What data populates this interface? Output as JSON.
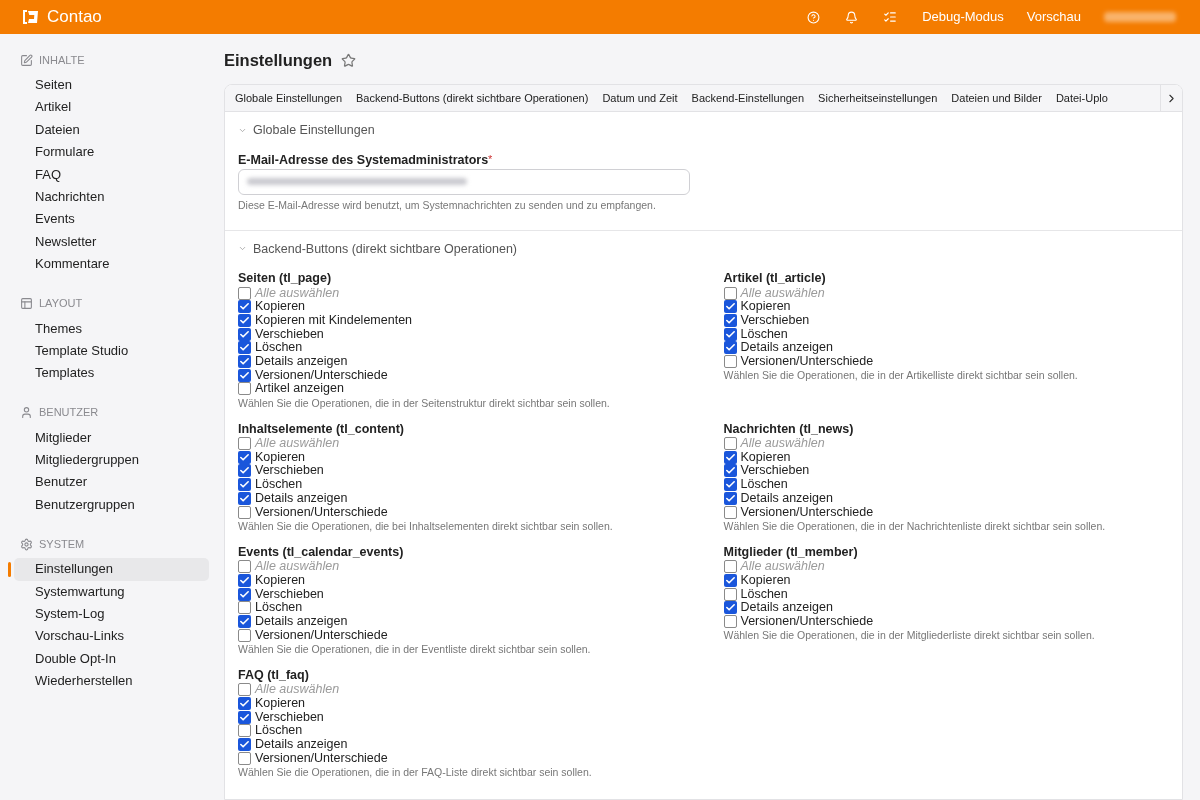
{
  "header": {
    "brand": "Contao",
    "links": [
      "Debug-Modus",
      "Vorschau"
    ]
  },
  "sidebar": [
    {
      "title": "INHALTE",
      "items": [
        {
          "label": "Seiten",
          "selected": false
        },
        {
          "label": "Artikel",
          "selected": false
        },
        {
          "label": "Dateien",
          "selected": false
        },
        {
          "label": "Formulare",
          "selected": false
        },
        {
          "label": "FAQ",
          "selected": false
        },
        {
          "label": "Nachrichten",
          "selected": false
        },
        {
          "label": "Events",
          "selected": false
        },
        {
          "label": "Newsletter",
          "selected": false
        },
        {
          "label": "Kommentare",
          "selected": false
        }
      ]
    },
    {
      "title": "LAYOUT",
      "items": [
        {
          "label": "Themes",
          "selected": false
        },
        {
          "label": "Template Studio",
          "selected": false
        },
        {
          "label": "Templates",
          "selected": false
        }
      ]
    },
    {
      "title": "BENUTZER",
      "items": [
        {
          "label": "Mitglieder",
          "selected": false
        },
        {
          "label": "Mitgliedergruppen",
          "selected": false
        },
        {
          "label": "Benutzer",
          "selected": false
        },
        {
          "label": "Benutzergruppen",
          "selected": false
        }
      ]
    },
    {
      "title": "SYSTEM",
      "items": [
        {
          "label": "Einstellungen",
          "selected": true
        },
        {
          "label": "Systemwartung",
          "selected": false
        },
        {
          "label": "System-Log",
          "selected": false
        },
        {
          "label": "Vorschau-Links",
          "selected": false
        },
        {
          "label": "Double Opt-In",
          "selected": false
        },
        {
          "label": "Wiederherstellen",
          "selected": false
        }
      ]
    }
  ],
  "page_title": "Einstellungen",
  "tabs": [
    "Globale Einstellungen",
    "Backend-Buttons (direkt sichtbare Operationen)",
    "Datum und Zeit",
    "Backend-Einstellungen",
    "Sicherheitseinstellungen",
    "Dateien und Bilder",
    "Datei-Uplo"
  ],
  "sections": [
    {
      "kind": "fields",
      "legend": "Globale Einstellungen",
      "fields": [
        {
          "label": "E-Mail-Adresse des Systemadministrators",
          "required_mark": "*",
          "help": "Diese E-Mail-Adresse wird benutzt, um Systemnachrichten zu senden und zu empfangen."
        }
      ]
    },
    {
      "kind": "checkbox_groups",
      "legend": "Backend-Buttons (direkt sichtbare Operationen)",
      "groups": [
        {
          "title": "Seiten (tl_page)",
          "help": "Wählen Sie die Operationen, die in der Seitenstruktur direkt sichtbar sein sollen.",
          "options": [
            {
              "kind": "select_all",
              "label": "Alle auswählen",
              "checked": false
            },
            {
              "kind": "option",
              "label": "Kopieren",
              "checked": true
            },
            {
              "kind": "option",
              "label": "Kopieren mit Kindelementen",
              "checked": true
            },
            {
              "kind": "option",
              "label": "Verschieben",
              "checked": true
            },
            {
              "kind": "option",
              "label": "Löschen",
              "checked": true
            },
            {
              "kind": "option",
              "label": "Details anzeigen",
              "checked": true
            },
            {
              "kind": "option",
              "label": "Versionen/Unterschiede",
              "checked": true
            },
            {
              "kind": "option",
              "label": "Artikel anzeigen",
              "checked": false
            }
          ]
        },
        {
          "title": "Artikel (tl_article)",
          "help": "Wählen Sie die Operationen, die in der Artikelliste direkt sichtbar sein sollen.",
          "options": [
            {
              "kind": "select_all",
              "label": "Alle auswählen",
              "checked": false
            },
            {
              "kind": "option",
              "label": "Kopieren",
              "checked": true
            },
            {
              "kind": "option",
              "label": "Verschieben",
              "checked": true
            },
            {
              "kind": "option",
              "label": "Löschen",
              "checked": true
            },
            {
              "kind": "option",
              "label": "Details anzeigen",
              "checked": true
            },
            {
              "kind": "option",
              "label": "Versionen/Unterschiede",
              "checked": false
            }
          ]
        },
        {
          "title": "Inhaltselemente (tl_content)",
          "help": "Wählen Sie die Operationen, die bei Inhaltselementen direkt sichtbar sein sollen.",
          "options": [
            {
              "kind": "select_all",
              "label": "Alle auswählen",
              "checked": false
            },
            {
              "kind": "option",
              "label": "Kopieren",
              "checked": true
            },
            {
              "kind": "option",
              "label": "Verschieben",
              "checked": true
            },
            {
              "kind": "option",
              "label": "Löschen",
              "checked": true
            },
            {
              "kind": "option",
              "label": "Details anzeigen",
              "checked": true
            },
            {
              "kind": "option",
              "label": "Versionen/Unterschiede",
              "checked": false
            }
          ]
        },
        {
          "title": "Nachrichten (tl_news)",
          "help": "Wählen Sie die Operationen, die in der Nachrichtenliste direkt sichtbar sein sollen.",
          "options": [
            {
              "kind": "select_all",
              "label": "Alle auswählen",
              "checked": false
            },
            {
              "kind": "option",
              "label": "Kopieren",
              "checked": true
            },
            {
              "kind": "option",
              "label": "Verschieben",
              "checked": true
            },
            {
              "kind": "option",
              "label": "Löschen",
              "checked": true
            },
            {
              "kind": "option",
              "label": "Details anzeigen",
              "checked": true
            },
            {
              "kind": "option",
              "label": "Versionen/Unterschiede",
              "checked": false
            }
          ]
        },
        {
          "title": "Events (tl_calendar_events)",
          "help": "Wählen Sie die Operationen, die in der Eventliste direkt sichtbar sein sollen.",
          "options": [
            {
              "kind": "select_all",
              "label": "Alle auswählen",
              "checked": false
            },
            {
              "kind": "option",
              "label": "Kopieren",
              "checked": true
            },
            {
              "kind": "option",
              "label": "Verschieben",
              "checked": true
            },
            {
              "kind": "option",
              "label": "Löschen",
              "checked": false
            },
            {
              "kind": "option",
              "label": "Details anzeigen",
              "checked": true
            },
            {
              "kind": "option",
              "label": "Versionen/Unterschiede",
              "checked": false
            }
          ]
        },
        {
          "title": "Mitglieder (tl_member)",
          "help": "Wählen Sie die Operationen, die in der Mitgliederliste direkt sichtbar sein sollen.",
          "options": [
            {
              "kind": "select_all",
              "label": "Alle auswählen",
              "checked": false
            },
            {
              "kind": "option",
              "label": "Kopieren",
              "checked": true
            },
            {
              "kind": "option",
              "label": "Löschen",
              "checked": false
            },
            {
              "kind": "option",
              "label": "Details anzeigen",
              "checked": true
            },
            {
              "kind": "option",
              "label": "Versionen/Unterschiede",
              "checked": false
            }
          ]
        },
        {
          "title": "FAQ (tl_faq)",
          "help": "Wählen Sie die Operationen, die in der FAQ-Liste direkt sichtbar sein sollen.",
          "options": [
            {
              "kind": "select_all",
              "label": "Alle auswählen",
              "checked": false
            },
            {
              "kind": "option",
              "label": "Kopieren",
              "checked": true
            },
            {
              "kind": "option",
              "label": "Verschieben",
              "checked": true
            },
            {
              "kind": "option",
              "label": "Löschen",
              "checked": false
            },
            {
              "kind": "option",
              "label": "Details anzeigen",
              "checked": true
            },
            {
              "kind": "option",
              "label": "Versionen/Unterschiede",
              "checked": false
            }
          ]
        }
      ]
    }
  ]
}
